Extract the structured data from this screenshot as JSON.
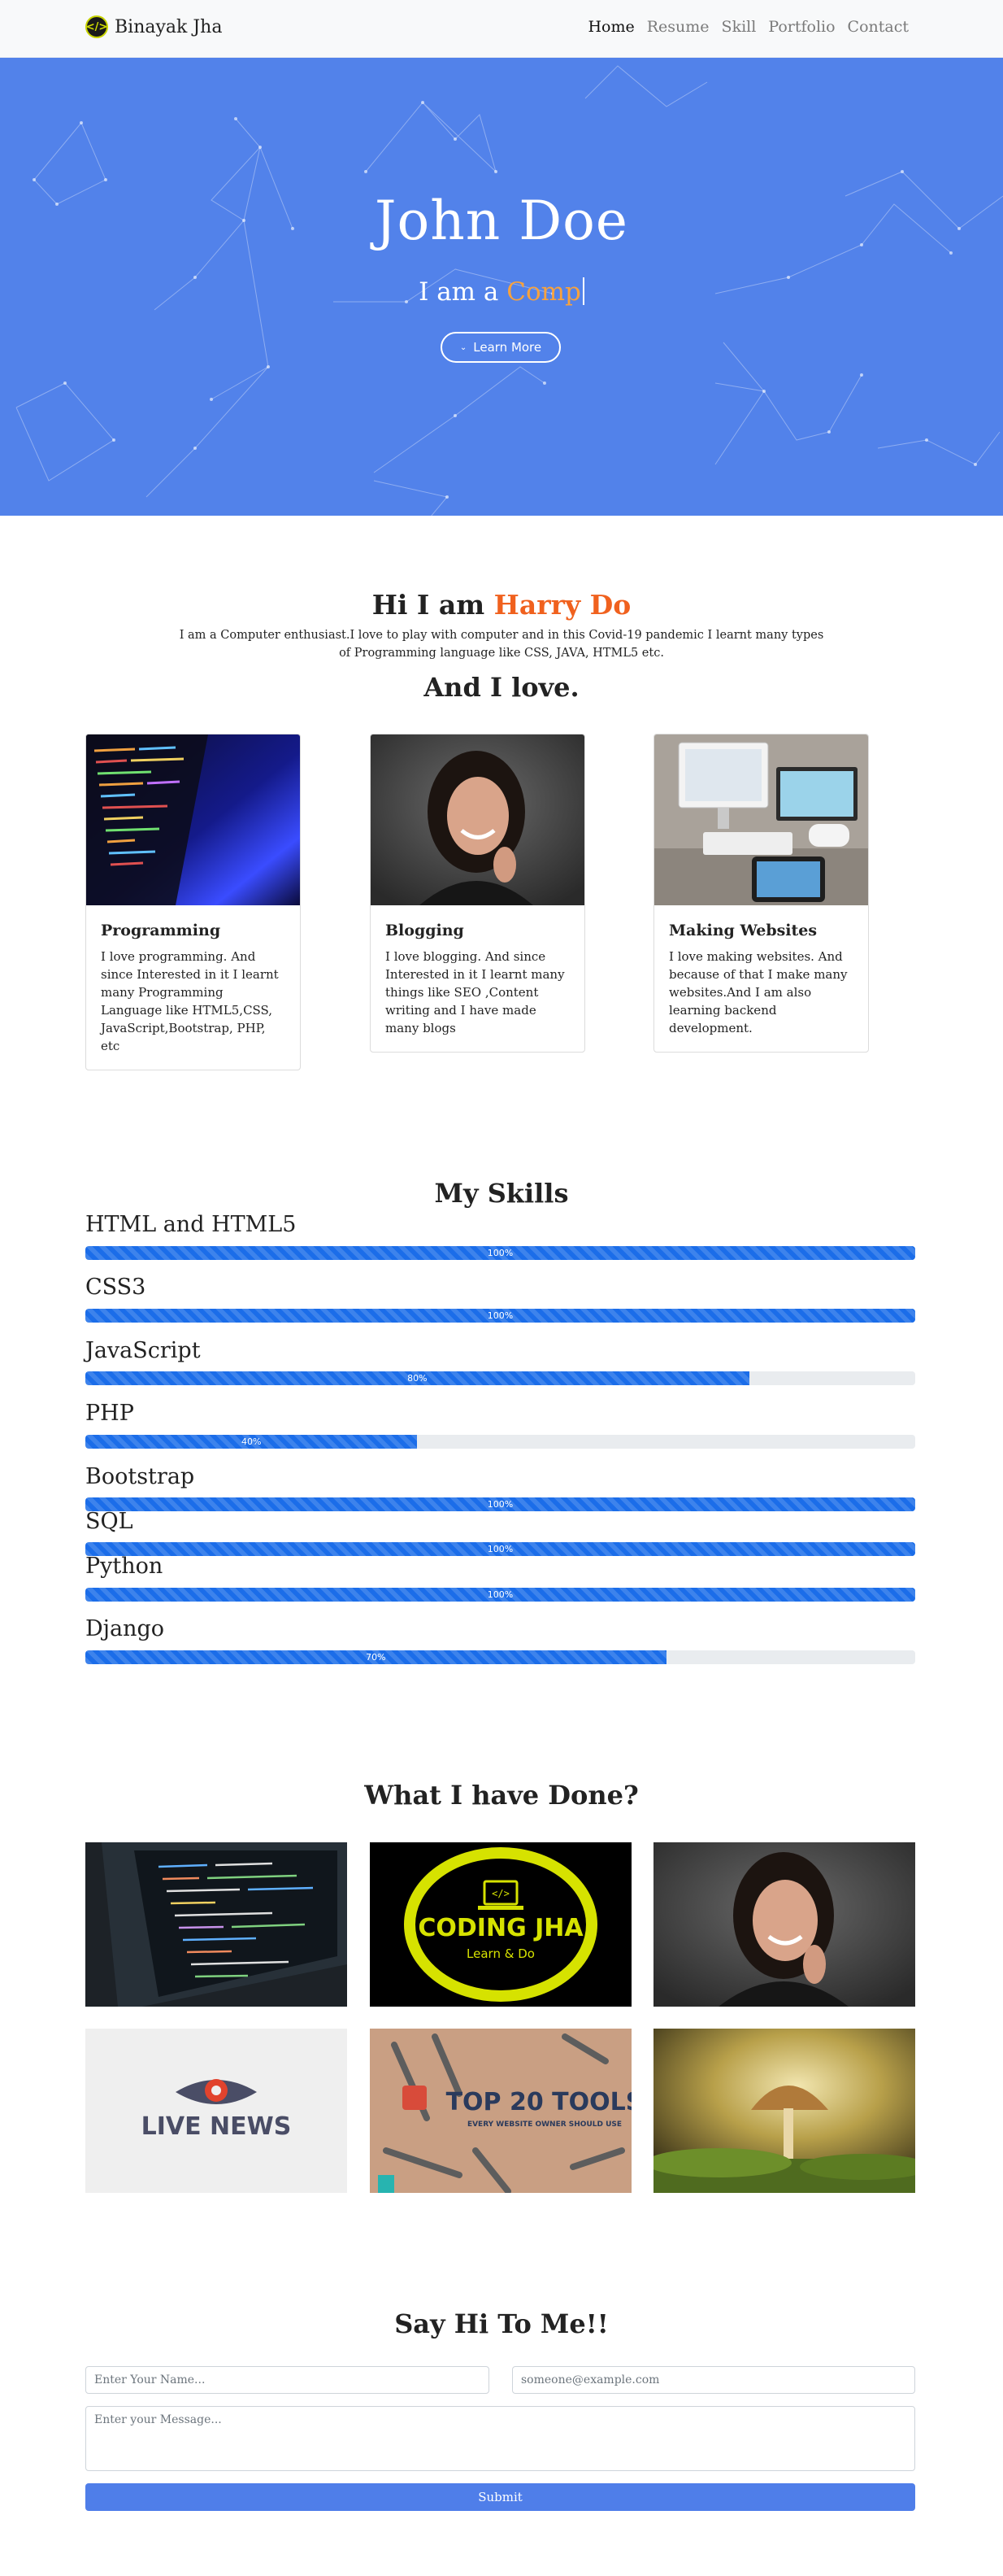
{
  "navbar": {
    "brand": "Binayak Jha",
    "links": [
      "Home",
      "Resume",
      "Skill",
      "Portfolio",
      "Contact"
    ]
  },
  "hero": {
    "title": "John Doe",
    "subtitle_prefix": "I am a ",
    "subtitle_typed": "Comp",
    "button_label": "Learn More"
  },
  "about": {
    "heading_prefix": "Hi I am ",
    "heading_name": "Harry Do",
    "description": "I am a Computer enthusiast.I love to play with computer and in this Covid-19 pandemic I learnt many types of Programming language like CSS, JAVA, HTML5 etc.",
    "love_heading": "And I love.",
    "cards": [
      {
        "title": "Programming",
        "text": "I love programming. And since Interested in it I learnt many Programming Language like HTML5,CSS, JavaScript,Bootstrap, PHP, etc"
      },
      {
        "title": "Blogging",
        "text": "I love blogging. And since Interested in it I learnt many things like SEO ,Content writing and I have made many blogs"
      },
      {
        "title": "Making Websites",
        "text": "I love making websites. And because of that I make many websites.And I am also learning backend development."
      }
    ]
  },
  "skills": {
    "heading": "My Skills",
    "items": [
      {
        "name": "HTML and HTML5",
        "percent": 100,
        "label": "100%"
      },
      {
        "name": "CSS3",
        "percent": 100,
        "label": "100%"
      },
      {
        "name": "JavaScript",
        "percent": 80,
        "label": "80%"
      },
      {
        "name": "PHP",
        "percent": 40,
        "label": "40%"
      },
      {
        "name": "Bootstrap",
        "percent": 100,
        "label": "100%"
      },
      {
        "name": "SQL",
        "percent": 100,
        "label": "100%"
      },
      {
        "name": "Python",
        "percent": 100,
        "label": "100%"
      },
      {
        "name": "Django",
        "percent": 70,
        "label": "70%"
      }
    ]
  },
  "portfolio": {
    "heading": "What I have Done?",
    "tiles": [
      {
        "kind": "laptop-code"
      },
      {
        "kind": "logo",
        "title": "CODING JHA",
        "tagline": "Learn & Do"
      },
      {
        "kind": "portrait"
      },
      {
        "kind": "logo",
        "title": "LIVE NEWS"
      },
      {
        "kind": "tools",
        "title": "TOP 20 TOOLS",
        "tagline": "EVERY WEBSITE OWNER SHOULD USE"
      },
      {
        "kind": "mushroom"
      }
    ]
  },
  "contact": {
    "heading": "Say Hi To Me!!",
    "name_placeholder": "Enter Your Name...",
    "email_placeholder": "someone@example.com",
    "message_placeholder": "Enter your Message...",
    "submit_label": "Submit"
  },
  "colors": {
    "hero_bg": "#5282ea",
    "accent_orange": "#f0611e",
    "typed_orange": "#f7a23e",
    "progress_blue": "#1b6de9",
    "submit_blue": "#4f7ee9"
  }
}
